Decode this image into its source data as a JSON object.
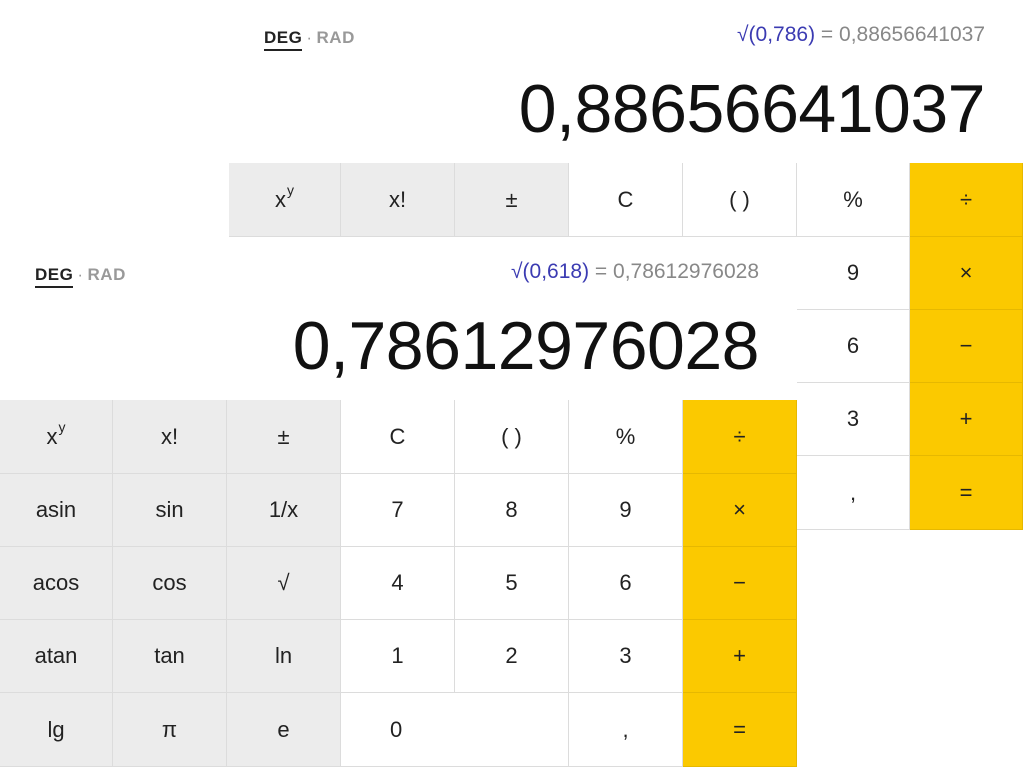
{
  "back": {
    "mode": {
      "deg": "DEG",
      "sep": "·",
      "rad": "RAD"
    },
    "history": {
      "expr": "√(0,786)",
      "rest": " = 0,88656641037"
    },
    "result": "0,88656641037",
    "keys": [
      {
        "id": "power",
        "label": "x",
        "sup": "y",
        "kind": "fn"
      },
      {
        "id": "factorial",
        "label": "x!",
        "kind": "fn"
      },
      {
        "id": "plus-minus",
        "label": "±",
        "kind": "fn"
      },
      {
        "id": "clear",
        "label": "C",
        "kind": "num"
      },
      {
        "id": "parentheses",
        "label": "( )",
        "kind": "num"
      },
      {
        "id": "percent",
        "label": "%",
        "kind": "num"
      },
      {
        "id": "divide",
        "label": "÷",
        "kind": "op"
      },
      {
        "id": "nine",
        "label": "9",
        "kind": "num"
      },
      {
        "id": "multiply",
        "label": "×",
        "kind": "op"
      },
      {
        "id": "six",
        "label": "6",
        "kind": "num"
      },
      {
        "id": "minus",
        "label": "−",
        "kind": "op"
      },
      {
        "id": "three",
        "label": "3",
        "kind": "num"
      },
      {
        "id": "plus",
        "label": "+",
        "kind": "op"
      },
      {
        "id": "decimal",
        "label": ",",
        "kind": "num"
      },
      {
        "id": "equals",
        "label": "=",
        "kind": "op"
      }
    ]
  },
  "front": {
    "mode": {
      "deg": "DEG",
      "sep": "·",
      "rad": "RAD"
    },
    "history": {
      "expr": "√(0,618)",
      "rest": " = 0,78612976028"
    },
    "result": "0,78612976028",
    "keys": [
      {
        "id": "power",
        "label": "x",
        "sup": "y",
        "kind": "fn"
      },
      {
        "id": "factorial",
        "label": "x!",
        "kind": "fn"
      },
      {
        "id": "plus-minus",
        "label": "±",
        "kind": "fn"
      },
      {
        "id": "clear",
        "label": "C",
        "kind": "num"
      },
      {
        "id": "parentheses",
        "label": "( )",
        "kind": "num"
      },
      {
        "id": "percent",
        "label": "%",
        "kind": "num"
      },
      {
        "id": "divide",
        "label": "÷",
        "kind": "op"
      },
      {
        "id": "asin",
        "label": "asin",
        "kind": "fn"
      },
      {
        "id": "sin",
        "label": "sin",
        "kind": "fn"
      },
      {
        "id": "reciprocal",
        "label": "1/x",
        "kind": "fn"
      },
      {
        "id": "seven",
        "label": "7",
        "kind": "num"
      },
      {
        "id": "eight",
        "label": "8",
        "kind": "num"
      },
      {
        "id": "nine",
        "label": "9",
        "kind": "num"
      },
      {
        "id": "multiply",
        "label": "×",
        "kind": "op"
      },
      {
        "id": "acos",
        "label": "acos",
        "kind": "fn"
      },
      {
        "id": "cos",
        "label": "cos",
        "kind": "fn"
      },
      {
        "id": "sqrt",
        "label": "√",
        "kind": "fn"
      },
      {
        "id": "four",
        "label": "4",
        "kind": "num"
      },
      {
        "id": "five",
        "label": "5",
        "kind": "num"
      },
      {
        "id": "six",
        "label": "6",
        "kind": "num"
      },
      {
        "id": "minus",
        "label": "−",
        "kind": "op"
      },
      {
        "id": "atan",
        "label": "atan",
        "kind": "fn"
      },
      {
        "id": "tan",
        "label": "tan",
        "kind": "fn"
      },
      {
        "id": "ln",
        "label": "ln",
        "kind": "fn"
      },
      {
        "id": "one",
        "label": "1",
        "kind": "num"
      },
      {
        "id": "two",
        "label": "2",
        "kind": "num"
      },
      {
        "id": "three",
        "label": "3",
        "kind": "num"
      },
      {
        "id": "plus",
        "label": "+",
        "kind": "op"
      },
      {
        "id": "lg",
        "label": "lg",
        "kind": "fn"
      },
      {
        "id": "pi",
        "label": "π",
        "kind": "fn"
      },
      {
        "id": "e",
        "label": "e",
        "kind": "fn"
      },
      {
        "id": "zero",
        "label": "0",
        "kind": "num"
      },
      {
        "id": "decimal",
        "label": ",",
        "kind": "num"
      },
      {
        "id": "equals",
        "label": "=",
        "kind": "op"
      }
    ]
  }
}
